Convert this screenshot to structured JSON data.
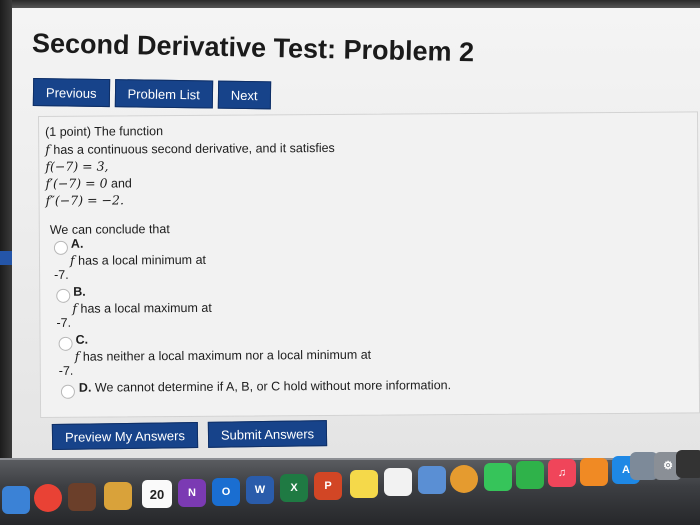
{
  "page": {
    "title": "Second Derivative Test: Problem 2"
  },
  "nav": {
    "previous": "Previous",
    "problem_list": "Problem List",
    "next": "Next"
  },
  "problem": {
    "intro": "(1 point) The function",
    "f_symbol": "f",
    "cond_text": "has a continuous second derivative, and it satisfies",
    "eq1": "f(−7) = 3,",
    "eq2": "f′(−7) = 0",
    "eq2_and": "and",
    "eq3": "f″(−7) = −2.",
    "conclude": "We can conclude that",
    "options": [
      {
        "letter": "A.",
        "text": "has a local minimum at",
        "value": "-7."
      },
      {
        "letter": "B.",
        "text": "has a local maximum at",
        "value": "-7."
      },
      {
        "letter": "C.",
        "text": "has neither a local maximum nor a local minimum at",
        "value": "-7."
      },
      {
        "letter": "D.",
        "text": "We cannot determine if A, B, or C hold without more information."
      }
    ]
  },
  "actions": {
    "preview": "Preview My Answers",
    "submit": "Submit Answers"
  },
  "dock": {
    "calendar_day": "20",
    "apps": [
      {
        "name": "finder",
        "label": "",
        "color": "#3b82d6"
      },
      {
        "name": "chrome",
        "label": "",
        "color": "#e94235"
      },
      {
        "name": "photo-booth",
        "label": "",
        "color": "#6b3f2a"
      },
      {
        "name": "notes-app",
        "label": "",
        "color": "#d9a23a"
      },
      {
        "name": "onenote",
        "label": "N",
        "color": "#7b3ab3"
      },
      {
        "name": "outlook",
        "label": "O",
        "color": "#1a6ed1"
      },
      {
        "name": "word",
        "label": "W",
        "color": "#2a5cab"
      },
      {
        "name": "excel",
        "label": "X",
        "color": "#1f7a43"
      },
      {
        "name": "powerpoint",
        "label": "P",
        "color": "#d24625"
      },
      {
        "name": "stickies",
        "label": "",
        "color": "#f5d94a"
      },
      {
        "name": "reminders",
        "label": "",
        "color": "#f2f2f2"
      },
      {
        "name": "preview",
        "label": "",
        "color": "#5a8fd4"
      },
      {
        "name": "photos",
        "label": "",
        "color": "#e59b2f"
      },
      {
        "name": "messages",
        "label": "",
        "color": "#36c45a"
      },
      {
        "name": "facetime",
        "label": "",
        "color": "#2fb24a"
      },
      {
        "name": "music",
        "label": "♫",
        "color": "#f0455a"
      },
      {
        "name": "books",
        "label": "",
        "color": "#f08a24"
      },
      {
        "name": "app-store",
        "label": "A",
        "color": "#1e88e5"
      },
      {
        "name": "image-capture",
        "label": "",
        "color": "#7d8a99"
      },
      {
        "name": "system-preferences",
        "label": "⚙",
        "color": "#8a8f96"
      },
      {
        "name": "terminal",
        "label": "",
        "color": "#333"
      }
    ]
  }
}
